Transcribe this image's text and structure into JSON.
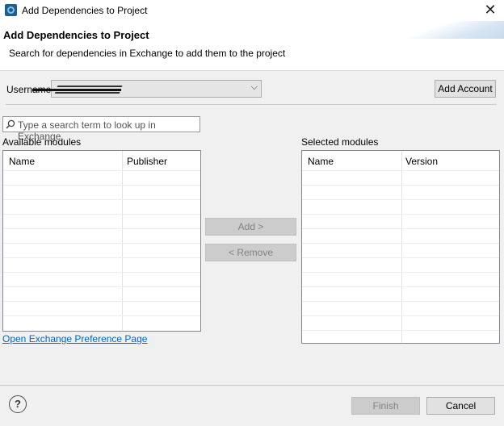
{
  "window": {
    "title": "Add Dependencies to Project",
    "close_glyph": "✕"
  },
  "header": {
    "title": "Add Dependencies to Project",
    "subtitle": "Search for dependencies in Exchange to add them to the project"
  },
  "account": {
    "username_label": "Username",
    "username_value": "",
    "add_account_label": "Add Account"
  },
  "search": {
    "placeholder": "Type a search term to look up in Exchange"
  },
  "available": {
    "label": "Available modules",
    "columns": [
      "Name",
      "Publisher"
    ],
    "rows": []
  },
  "selected": {
    "label": "Selected modules",
    "columns": [
      "Name",
      "Version"
    ],
    "rows": []
  },
  "actions": {
    "add_label": "Add >",
    "remove_label": "< Remove"
  },
  "link": {
    "preferences_label": "Open Exchange Preference Page"
  },
  "footer": {
    "help_glyph": "?",
    "finish_label": "Finish",
    "cancel_label": "Cancel"
  },
  "colors": {
    "link": "#0066cc",
    "body_bg": "#f0f0f0",
    "focus_border": "#0078d7"
  },
  "icons": {
    "app": "eclipse-app-icon",
    "search": "search-icon",
    "help": "help-icon",
    "close": "close-icon",
    "dropdown": "chevron-down-icon"
  }
}
